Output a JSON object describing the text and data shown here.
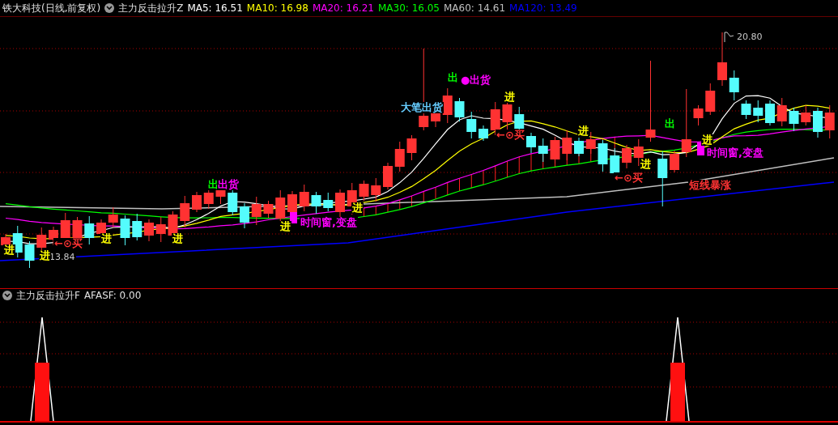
{
  "header": {
    "title": "铁大科技(日线,前复权)",
    "indicator": "主力反击拉升Z",
    "moving_averages": [
      {
        "label": "MA5: 16.51",
        "color": "#ffffff"
      },
      {
        "label": "MA10: 16.98",
        "color": "#ffff00"
      },
      {
        "label": "MA20: 16.21",
        "color": "#ff00ff"
      },
      {
        "label": "MA30: 16.05",
        "color": "#00ff00"
      },
      {
        "label": "MA60: 14.61",
        "color": "#c0c0c0"
      },
      {
        "label": "MA120: 13.49",
        "color": "#0000ff"
      }
    ]
  },
  "main_chart": {
    "price_labels": [
      {
        "text": "20.80",
        "kind": "high"
      },
      {
        "text": "13.84",
        "kind": "low"
      }
    ],
    "annotations": [
      {
        "text": "进",
        "color": "#ffff00"
      },
      {
        "text": "进",
        "color": "#ffff00"
      },
      {
        "text": "进",
        "color": "#ffff00"
      },
      {
        "text": "进",
        "color": "#ffff00"
      },
      {
        "text": "进",
        "color": "#ffff00"
      },
      {
        "text": "进",
        "color": "#ffff00"
      },
      {
        "text": "进",
        "color": "#ffff00"
      },
      {
        "text": "进",
        "color": "#ffff00"
      },
      {
        "text": "进",
        "color": "#ffff00"
      },
      {
        "text": "进",
        "color": "#ffff00"
      },
      {
        "text": "←⊙买",
        "color": "#ff3333"
      },
      {
        "text": "←⊙买",
        "color": "#ff3333"
      },
      {
        "text": "←⊙买",
        "color": "#ff3333"
      },
      {
        "text": "出",
        "color": "#00ff00"
      },
      {
        "text": "出货",
        "color": "#ff00ff"
      },
      {
        "text": "出",
        "color": "#00ff00"
      },
      {
        "text": "●出货",
        "color": "#ff00ff"
      },
      {
        "text": "大笔出货",
        "color": "#66ccff"
      },
      {
        "text": "出",
        "color": "#00ff00"
      },
      {
        "text": "时间窗,变盘",
        "color": "#ff00ff"
      },
      {
        "text": "时间窗,变盘",
        "color": "#ff00ff"
      },
      {
        "text": "短线暴涨",
        "color": "#ff3333"
      }
    ]
  },
  "lower_chart": {
    "indicator": "主力反击拉升F",
    "reading": "AFASF: 0.00"
  }
}
